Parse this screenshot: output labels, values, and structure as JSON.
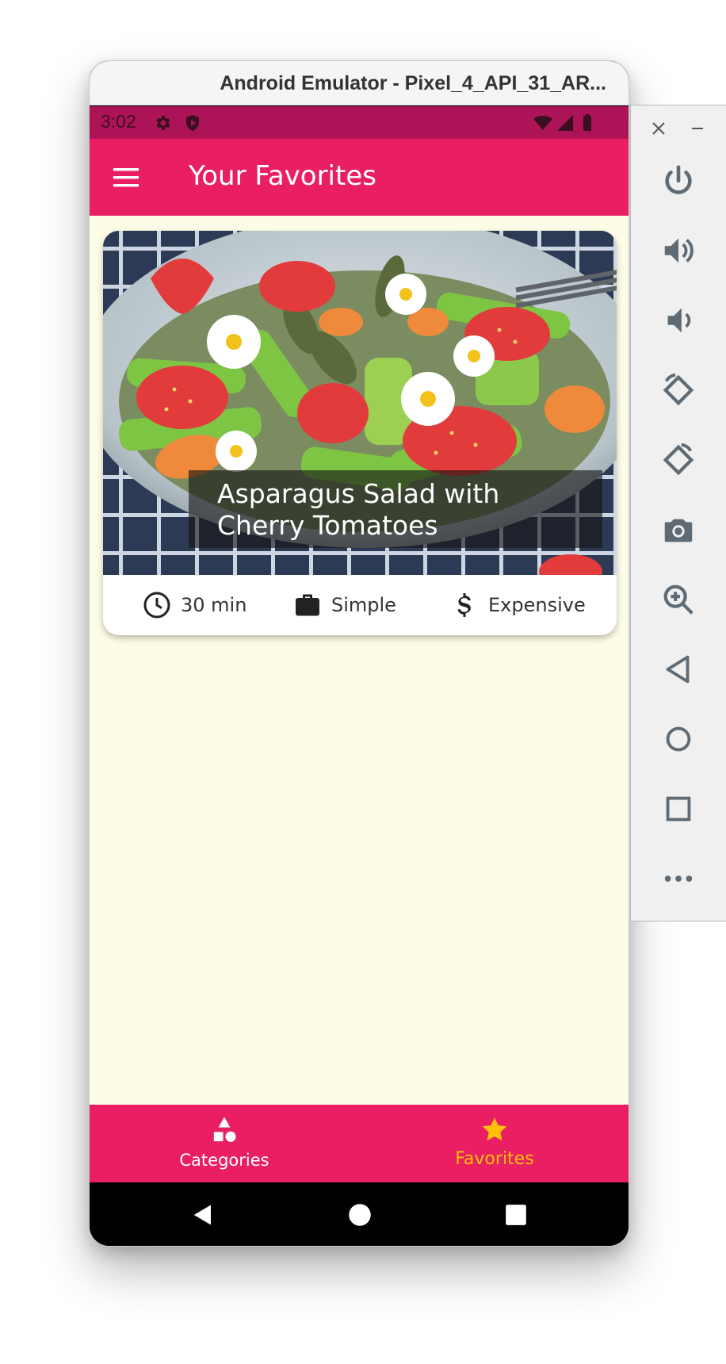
{
  "window": {
    "title": "Android Emulator - Pixel_4_API_31_AR..."
  },
  "status_bar": {
    "time": "3:02"
  },
  "app_bar": {
    "title": "Your Favorites",
    "menu_icon": "hamburger-menu-icon"
  },
  "meal_card": {
    "title": "Asparagus Salad with Cherry Tomatoes",
    "duration": "30 min",
    "complexity": "Simple",
    "affordability": "Expensive"
  },
  "bottom_nav": {
    "items": [
      {
        "label": "Categories",
        "icon": "categories-icon",
        "selected": false
      },
      {
        "label": "Favorites",
        "icon": "star-icon",
        "selected": true
      }
    ]
  },
  "colors": {
    "primary": "#e91e63",
    "primary_dark": "#ad1457",
    "accent": "#ffc107",
    "background": "#fdfce6"
  },
  "toolbar": {
    "buttons": [
      "power-icon",
      "volume-up-icon",
      "volume-down-icon",
      "rotate-left-icon",
      "rotate-right-icon",
      "camera-icon",
      "zoom-icon",
      "back-icon",
      "home-icon",
      "overview-icon",
      "more-icon"
    ]
  }
}
